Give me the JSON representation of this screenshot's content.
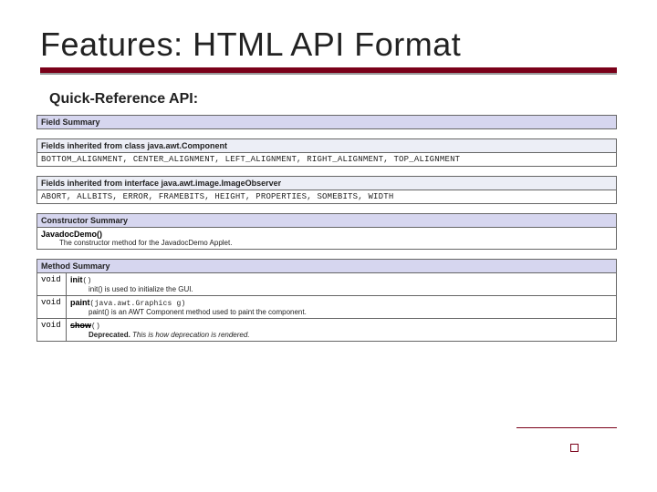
{
  "title": "Features: HTML API Format",
  "subheading": "Quick-Reference API:",
  "sections": {
    "field_summary": {
      "heading": "Field Summary",
      "inherit1_label": "Fields inherited from class java.awt.Component",
      "inherit1_values": "BOTTOM_ALIGNMENT, CENTER_ALIGNMENT, LEFT_ALIGNMENT, RIGHT_ALIGNMENT, TOP_ALIGNMENT",
      "inherit2_label": "Fields inherited from interface java.awt.image.ImageObserver",
      "inherit2_values": "ABORT, ALLBITS, ERROR, FRAMEBITS, HEIGHT, PROPERTIES, SOMEBITS, WIDTH"
    },
    "constructor_summary": {
      "heading": "Constructor Summary",
      "signature": "JavadocDemo()",
      "description": "The constructor method for the JavadocDemo Applet."
    },
    "method_summary": {
      "heading": "Method Summary",
      "methods": [
        {
          "ret": "void",
          "name": "init",
          "sig": "()",
          "desc": "init() is used to initialize the GUI."
        },
        {
          "ret": "void",
          "name": "paint",
          "sig": "(java.awt.Graphics g)",
          "desc": "paint() is an AWT Component method used to paint the component."
        },
        {
          "ret": "void",
          "name": "show",
          "sig": "()",
          "desc_prefix": "Deprecated. ",
          "desc_em": "This is how deprecation is rendered."
        }
      ]
    }
  }
}
